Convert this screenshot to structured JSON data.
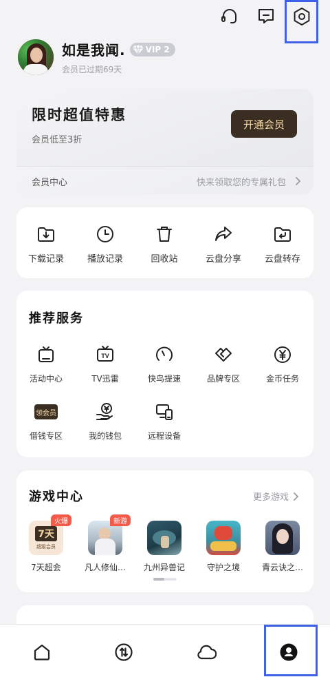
{
  "topbar": {
    "icons": [
      "headset-icon",
      "feedback-message-icon",
      "settings-hexagon-icon"
    ]
  },
  "profile": {
    "username": "如是我闻.",
    "vip_level": "VIP 2",
    "expired_text": "会员已过期69天"
  },
  "vip_card": {
    "title": "限时超值特惠",
    "subtitle": "会员低至3折",
    "open_button": "开通会员",
    "center_label": "会员中心",
    "gift_text": "快来领取您的专属礼包"
  },
  "quick_actions": [
    {
      "label": "下载记录",
      "icon": "download-folder-icon"
    },
    {
      "label": "播放记录",
      "icon": "clock-icon"
    },
    {
      "label": "回收站",
      "icon": "trash-icon"
    },
    {
      "label": "云盘分享",
      "icon": "share-arrow-icon"
    },
    {
      "label": "云盘转存",
      "icon": "folder-return-icon"
    }
  ],
  "recommended": {
    "title": "推荐服务",
    "items": [
      {
        "label": "活动中心",
        "icon": "tv-box-icon"
      },
      {
        "label": "TV迅雷",
        "icon": "tv-icon"
      },
      {
        "label": "快鸟提速",
        "icon": "speedometer-icon"
      },
      {
        "label": "品牌专区",
        "icon": "handshake-icon"
      },
      {
        "label": "金币任务",
        "icon": "yen-coin-icon"
      },
      {
        "label": "借钱专区",
        "icon": "coupon-badge-icon",
        "chip": "领会员"
      },
      {
        "label": "我的钱包",
        "icon": "wallet-hand-icon"
      },
      {
        "label": "远程设备",
        "icon": "remote-device-icon"
      }
    ]
  },
  "games": {
    "title": "游戏中心",
    "more": "更多游戏",
    "items": [
      {
        "label": "7天超会",
        "tag": "火爆",
        "thumb_text": "7天",
        "thumb_sub": "超级会员"
      },
      {
        "label": "凡人修仙…",
        "tag": "新游"
      },
      {
        "label": "九州异兽记"
      },
      {
        "label": "守护之境"
      },
      {
        "label": "青云诀之…"
      }
    ]
  },
  "tabbar": {
    "tabs": [
      "home-icon",
      "transfer-icon",
      "cloud-icon",
      "profile-icon"
    ],
    "active": "profile-icon"
  },
  "colors": {
    "highlight": "#3d62e8",
    "vip_button_bg": "#3a2e23",
    "vip_button_text": "#f5d8a8",
    "tag_red": "#f25a4a"
  }
}
